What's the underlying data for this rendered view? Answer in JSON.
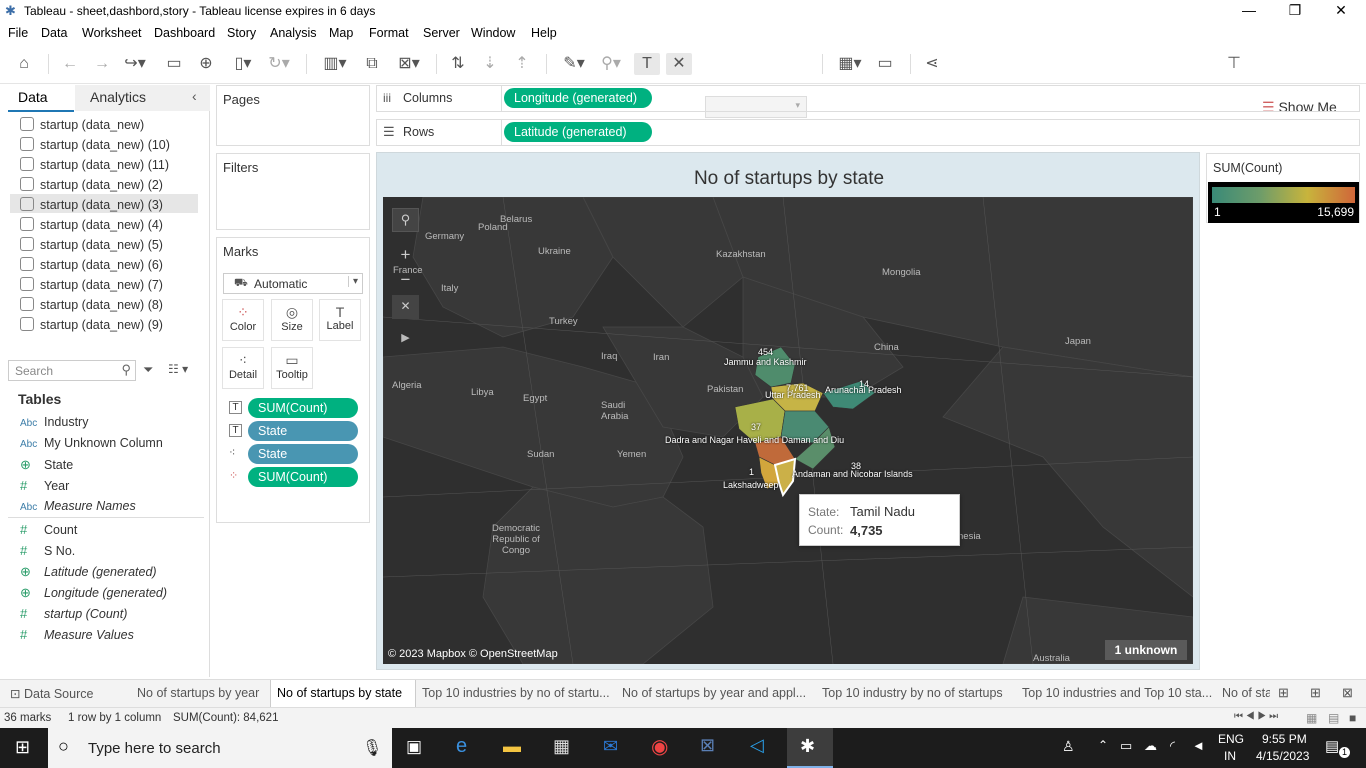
{
  "window": {
    "title": "Tableau - sheet,dashbord,story - Tableau license expires in 6 days"
  },
  "menu": [
    "File",
    "Data",
    "Worksheet",
    "Dashboard",
    "Story",
    "Analysis",
    "Map",
    "Format",
    "Server",
    "Window",
    "Help"
  ],
  "toolbar": {
    "show_me": "Show Me"
  },
  "left": {
    "tabs": [
      "Data",
      "Analytics"
    ],
    "datasources": [
      "startup (data_new)",
      "startup (data_new) (10)",
      "startup (data_new) (11)",
      "startup (data_new) (2)",
      "startup (data_new) (3)",
      "startup (data_new) (4)",
      "startup (data_new) (5)",
      "startup (data_new) (6)",
      "startup (data_new) (7)",
      "startup (data_new) (8)",
      "startup (data_new) (9)"
    ],
    "search_placeholder": "Search",
    "tables_header": "Tables",
    "fields": [
      {
        "type": "Abc",
        "name": "Industry"
      },
      {
        "type": "Abc",
        "name": "My Unknown Column"
      },
      {
        "type": "geo",
        "name": "State"
      },
      {
        "type": "#",
        "name": "Year"
      },
      {
        "type": "Abc",
        "name": "Measure Names"
      },
      {
        "type": "#",
        "name": "Count"
      },
      {
        "type": "#",
        "name": "S No."
      },
      {
        "type": "geo",
        "name": "Latitude (generated)"
      },
      {
        "type": "geo",
        "name": "Longitude (generated)"
      },
      {
        "type": "#",
        "name": "startup (Count)"
      },
      {
        "type": "#",
        "name": "Measure Values"
      }
    ]
  },
  "cards": {
    "pages": "Pages",
    "filters": "Filters",
    "marks": "Marks",
    "mark_type": "Automatic",
    "mark_buttons": [
      "Color",
      "Size",
      "Label",
      "Detail",
      "Tooltip"
    ],
    "mark_pills": [
      "SUM(Count)",
      "State",
      "State",
      "SUM(Count)"
    ]
  },
  "shelves": {
    "columns_label": "Columns",
    "columns_pill": "Longitude (generated)",
    "rows_label": "Rows",
    "rows_pill": "Latitude (generated)"
  },
  "view": {
    "title": "No of startups by state",
    "legend_title": "SUM(Count)",
    "legend_min": "1",
    "legend_max": "15,699",
    "attribution": "© 2023 Mapbox © OpenStreetMap",
    "unknown": "1 unknown",
    "tooltip": {
      "state_label": "State:",
      "state": "Tamil Nadu",
      "count_label": "Count:",
      "count": "4,735"
    },
    "countries": [
      "Belarus",
      "Poland",
      "Germany",
      "Ukraine",
      "Kazakhstan",
      "Mongolia",
      "Italy",
      "Turkey",
      "Iraq",
      "Iran",
      "China",
      "Japan",
      "Algeria",
      "Libya",
      "Egypt",
      "Saudi Arabia",
      "Pakistan",
      "Sudan",
      "Yemen",
      "Democratic Republic of Congo",
      "Australia",
      "nesia",
      "France"
    ],
    "state_labels": [
      {
        "name": "Jammu and Kashmir",
        "value": "454"
      },
      {
        "name": "Uttar Pradesh",
        "value": "7,761"
      },
      {
        "name": "Arunachal Pradesh",
        "value": "14"
      },
      {
        "name": "Dadra and Nagar Haveli and Daman and Diu",
        "value": "37"
      },
      {
        "name": "Andaman and Nicobar Islands",
        "value": "38"
      },
      {
        "name": "Lakshadweep",
        "value": "1"
      }
    ],
    "colors": {
      "low": "#3a8a78",
      "mid": "#c8b43c",
      "high": "#d0663a"
    }
  },
  "sheet_tabs": [
    "Data Source",
    "No of startups by year",
    "No of startups by state",
    "Top 10 industries by no of startu...",
    "No of startups by year  and appl...",
    "Top 10 industry by no of startups",
    "Top 10 industries and Top 10 sta...",
    "No of sta"
  ],
  "status": {
    "marks": "36 marks",
    "rows": "1 row by 1 column",
    "sum": "SUM(Count): 84,621"
  },
  "taskbar": {
    "search": "Type here to search",
    "lang1": "ENG",
    "lang2": "IN",
    "time": "9:55 PM",
    "date": "4/15/2023",
    "notif": "1"
  }
}
